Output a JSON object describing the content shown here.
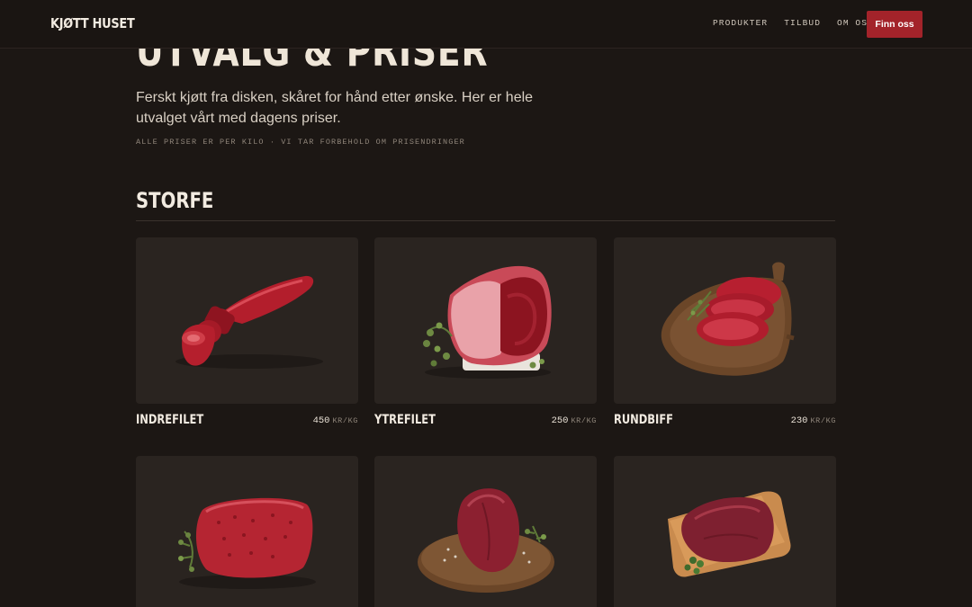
{
  "nav": {
    "logo": "KJØTT HUSET",
    "links": [
      "PRODUKTER",
      "TILBUD",
      "OM OSS"
    ],
    "cta": "Finn oss"
  },
  "hero": {
    "title": "UTVALG & PRISER",
    "lead": "Ferskt kjøtt fra disken, skåret for hånd etter ønske. Her er hele utvalget vårt med dagens priser.",
    "note": "ALLE PRISER ER PER KILO · VI TAR FORBEHOLD OM PRISENDRINGER"
  },
  "section": {
    "title": "STORFE",
    "products": [
      {
        "name": "INDREFILET",
        "price": "450",
        "unit": "KR/KG",
        "image": "tenderloin"
      },
      {
        "name": "YTREFILET",
        "price": "250",
        "unit": "KR/KG",
        "image": "sirloin-roast"
      },
      {
        "name": "RUNDBIFF",
        "price": "230",
        "unit": "KR/KG",
        "image": "steaks-on-board"
      },
      {
        "name": "",
        "price": "",
        "unit": "",
        "image": "ground-beef"
      },
      {
        "name": "",
        "price": "",
        "unit": "",
        "image": "heart-on-board"
      },
      {
        "name": "",
        "price": "",
        "unit": "",
        "image": "liver-on-board"
      }
    ]
  }
}
